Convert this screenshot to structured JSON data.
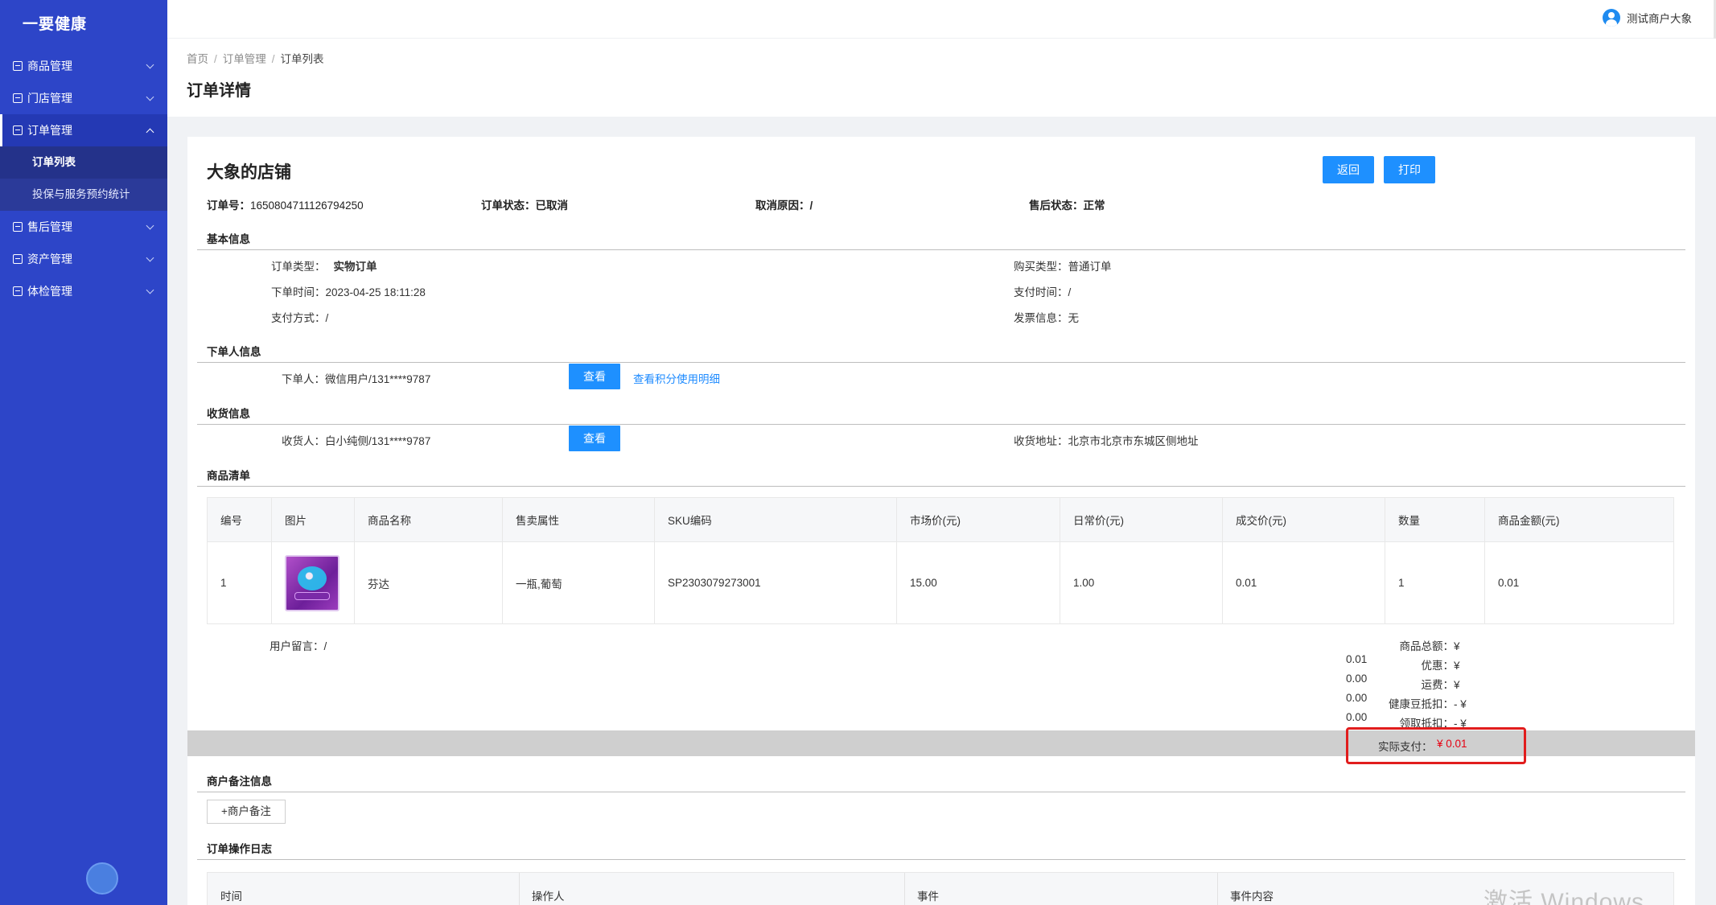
{
  "app": {
    "name": "一要健康"
  },
  "sidebar": {
    "items": [
      {
        "label": "商品管理"
      },
      {
        "label": "门店管理"
      },
      {
        "label": "订单管理",
        "children": [
          {
            "label": "订单列表"
          },
          {
            "label": "投保与服务预约统计"
          }
        ]
      },
      {
        "label": "售后管理"
      },
      {
        "label": "资产管理"
      },
      {
        "label": "体检管理"
      }
    ]
  },
  "header": {
    "user_name": "测试商户大象"
  },
  "breadcrumb": {
    "home": "首页",
    "parent": "订单管理",
    "current": "订单列表"
  },
  "page_title": "订单详情",
  "order": {
    "shop_name": "大象的店铺",
    "buttons": {
      "back": "返回",
      "print": "打印"
    },
    "order_no_label": "订单号：",
    "order_no": "1650804711126794250",
    "status_label": "订单状态：",
    "status": "已取消",
    "cancel_reason_label": "取消原因：",
    "cancel_reason": "/",
    "after_sale_label": "售后状态：",
    "after_sale": "正常"
  },
  "basic_info": {
    "title": "基本信息",
    "order_type_label": "订单类型：",
    "order_type": "实物订单",
    "purchase_type_label": "购买类型：",
    "purchase_type": "普通订单",
    "order_time_label": "下单时间：",
    "order_time": "2023-04-25 18:11:28",
    "pay_time_label": "支付时间：",
    "pay_time": "/",
    "pay_method_label": "支付方式：",
    "pay_method": "/",
    "invoice_label": "发票信息：",
    "invoice": "无"
  },
  "buyer_info": {
    "title": "下单人信息",
    "buyer_label": "下单人：",
    "buyer": "微信用户/131****9787",
    "view_button": "查看",
    "points_link": "查看积分使用明细"
  },
  "shipping_info": {
    "title": "收货信息",
    "receiver_label": "收货人：",
    "receiver": "白小纯侧/131****9787",
    "view_button": "查看",
    "address_label": "收货地址：",
    "address": "北京市北京市东城区侧地址"
  },
  "goods": {
    "title": "商品清单",
    "columns": [
      "编号",
      "图片",
      "商品名称",
      "售卖属性",
      "SKU编码",
      "市场价(元)",
      "日常价(元)",
      "成交价(元)",
      "数量",
      "商品金额(元)"
    ],
    "rows": [
      {
        "no": "1",
        "image": "fanta-grape-product-image",
        "name": "芬达",
        "attr": "一瓶,葡萄",
        "sku": "SP2303079273001",
        "market": "15.00",
        "daily": "1.00",
        "deal": "0.01",
        "qty": "1",
        "amount": "0.01"
      }
    ]
  },
  "remark": {
    "label": "用户留言：",
    "value": "/"
  },
  "totals": {
    "goods_total_label": "商品总额：",
    "goods_total": "¥ 0.01",
    "discount_label": "优惠：",
    "discount": "¥ 0.00",
    "shipping_label": "运费：",
    "shipping": "¥ 0.00",
    "bean_label": "健康豆抵扣：",
    "bean": "- ¥ 0.00",
    "claim_label": "领取抵扣：",
    "claim": "- ¥ 0.00",
    "paid_label": "实际支付：",
    "paid": "¥ 0.01",
    "paid_color": "#e60012"
  },
  "merchant_remark": {
    "title": "商户备注信息",
    "button": "+商户备注"
  },
  "log": {
    "title": "订单操作日志",
    "columns": [
      "时间",
      "操作人",
      "事件",
      "事件内容"
    ]
  },
  "watermark": "激活 Windows",
  "colors": {
    "sidebar": "#2d45c8",
    "primary": "#1e90ff",
    "highlight_box": "#e11d1d"
  }
}
